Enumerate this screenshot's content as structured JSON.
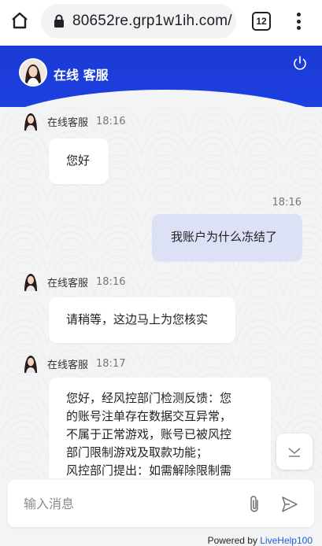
{
  "browser": {
    "url": "80652re.grp1w1ih.com/",
    "tab_count": "12"
  },
  "header": {
    "title": "在线 客服"
  },
  "messages": [
    {
      "from": "agent",
      "name": "在线客服",
      "time": "18:16",
      "text": "您好"
    },
    {
      "from": "user",
      "time": "18:16",
      "text": "我账户为什么冻结了"
    },
    {
      "from": "agent",
      "name": "在线客服",
      "time": "18:16",
      "text": "请稍等，这边马上为您核实"
    },
    {
      "from": "agent",
      "name": "在线客服",
      "time": "18:17",
      "lines": [
        "您好，经风控部门检测反馈：您",
        "的账号注单存在数据交互异常，",
        "不属于正常游戏，账号已被风控",
        "部门限制游戏及取款功能；",
        "风控部门提出：如需解除限制需"
      ]
    }
  ],
  "input": {
    "placeholder": "输入消息"
  },
  "footer": {
    "powered_prefix": "Powered by ",
    "powered_brand": "LiveHelp100"
  },
  "colors": {
    "header_blue": "#1d3fe0",
    "user_bubble": "#dde1f5",
    "brand_link": "#1d5be0"
  }
}
